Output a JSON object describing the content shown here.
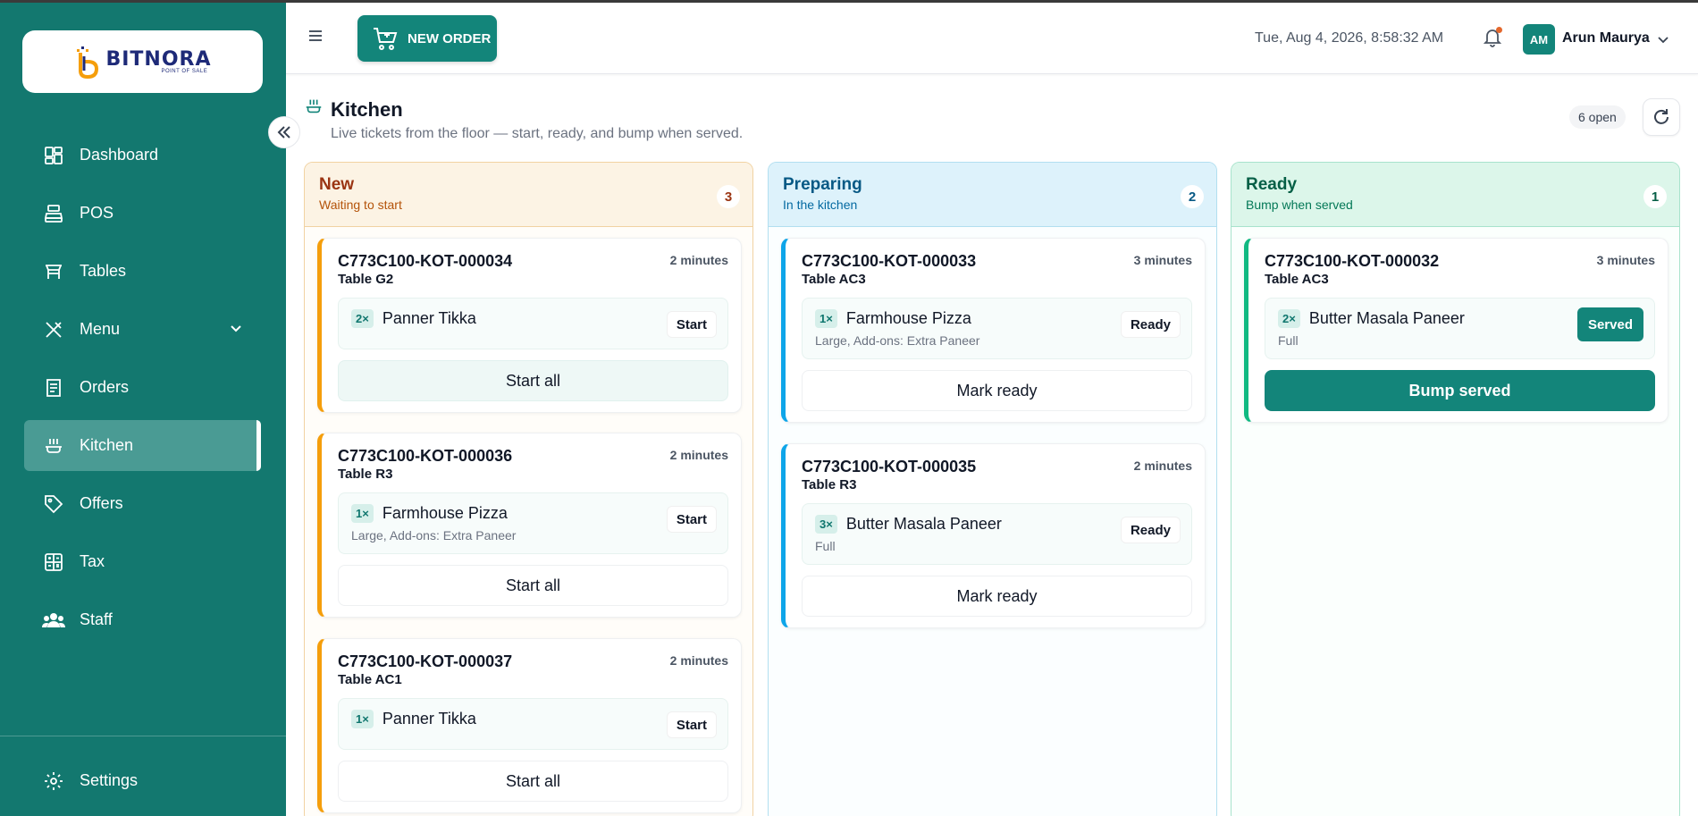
{
  "app": {
    "logo_word": "BITNORA",
    "logo_sub": "POINT OF SALE"
  },
  "sidebar": {
    "items": [
      {
        "label": "Dashboard",
        "icon": "dashboard-icon"
      },
      {
        "label": "POS",
        "icon": "cash-register-icon"
      },
      {
        "label": "Tables",
        "icon": "table-icon"
      },
      {
        "label": "Menu",
        "icon": "utensils-icon"
      },
      {
        "label": "Orders",
        "icon": "receipt-icon"
      },
      {
        "label": "Kitchen",
        "icon": "kitchen-icon",
        "active": true
      },
      {
        "label": "Offers",
        "icon": "tag-icon"
      },
      {
        "label": "Tax",
        "icon": "calculator-icon"
      },
      {
        "label": "Staff",
        "icon": "users-icon"
      }
    ],
    "settings_label": "Settings"
  },
  "header": {
    "new_order_label": "NEW ORDER",
    "datetime": "Tue, Aug 4, 2026, 8:58:32 AM",
    "avatar_initials": "AM",
    "user_name": "Arun Maurya"
  },
  "page": {
    "title": "Kitchen",
    "subtitle": "Live tickets from the floor — start, ready, and bump when served.",
    "open_count": "6 open"
  },
  "columns": {
    "new": {
      "title": "New",
      "subtitle": "Waiting to start",
      "count": "3",
      "tickets": [
        {
          "id": "C773C100-KOT-000034",
          "table": "Table G2",
          "time": "2 minutes",
          "item": {
            "qty": "2×",
            "name": "Panner Tikka",
            "mods": "",
            "button": "Start"
          },
          "action": "Start all"
        },
        {
          "id": "C773C100-KOT-000036",
          "table": "Table R3",
          "time": "2 minutes",
          "item": {
            "qty": "1×",
            "name": "Farmhouse Pizza",
            "mods": "Large, Add-ons: Extra Paneer",
            "button": "Start"
          },
          "action": "Start all"
        },
        {
          "id": "C773C100-KOT-000037",
          "table": "Table AC1",
          "time": "2 minutes",
          "item": {
            "qty": "1×",
            "name": "Panner Tikka",
            "mods": "",
            "button": "Start"
          },
          "action": "Start all"
        }
      ]
    },
    "preparing": {
      "title": "Preparing",
      "subtitle": "In the kitchen",
      "count": "2",
      "tickets": [
        {
          "id": "C773C100-KOT-000033",
          "table": "Table AC3",
          "time": "3 minutes",
          "item": {
            "qty": "1×",
            "name": "Farmhouse Pizza",
            "mods": "Large, Add-ons: Extra Paneer",
            "button": "Ready"
          },
          "action": "Mark ready"
        },
        {
          "id": "C773C100-KOT-000035",
          "table": "Table R3",
          "time": "2 minutes",
          "item": {
            "qty": "3×",
            "name": "Butter Masala Paneer",
            "mods": "Full",
            "button": "Ready"
          },
          "action": "Mark ready"
        }
      ]
    },
    "ready": {
      "title": "Ready",
      "subtitle": "Bump when served",
      "count": "1",
      "tickets": [
        {
          "id": "C773C100-KOT-000032",
          "table": "Table AC3",
          "time": "3 minutes",
          "item": {
            "qty": "2×",
            "name": "Butter Masala Paneer",
            "mods": "Full",
            "button": "Served"
          },
          "action": "Bump served"
        }
      ]
    }
  },
  "colors": {
    "sidebar_bg": "#13786f",
    "accent": "#13857a",
    "new_border": "#f59e0b",
    "preparing_border": "#0ea5e9",
    "ready_border": "#10b981"
  }
}
